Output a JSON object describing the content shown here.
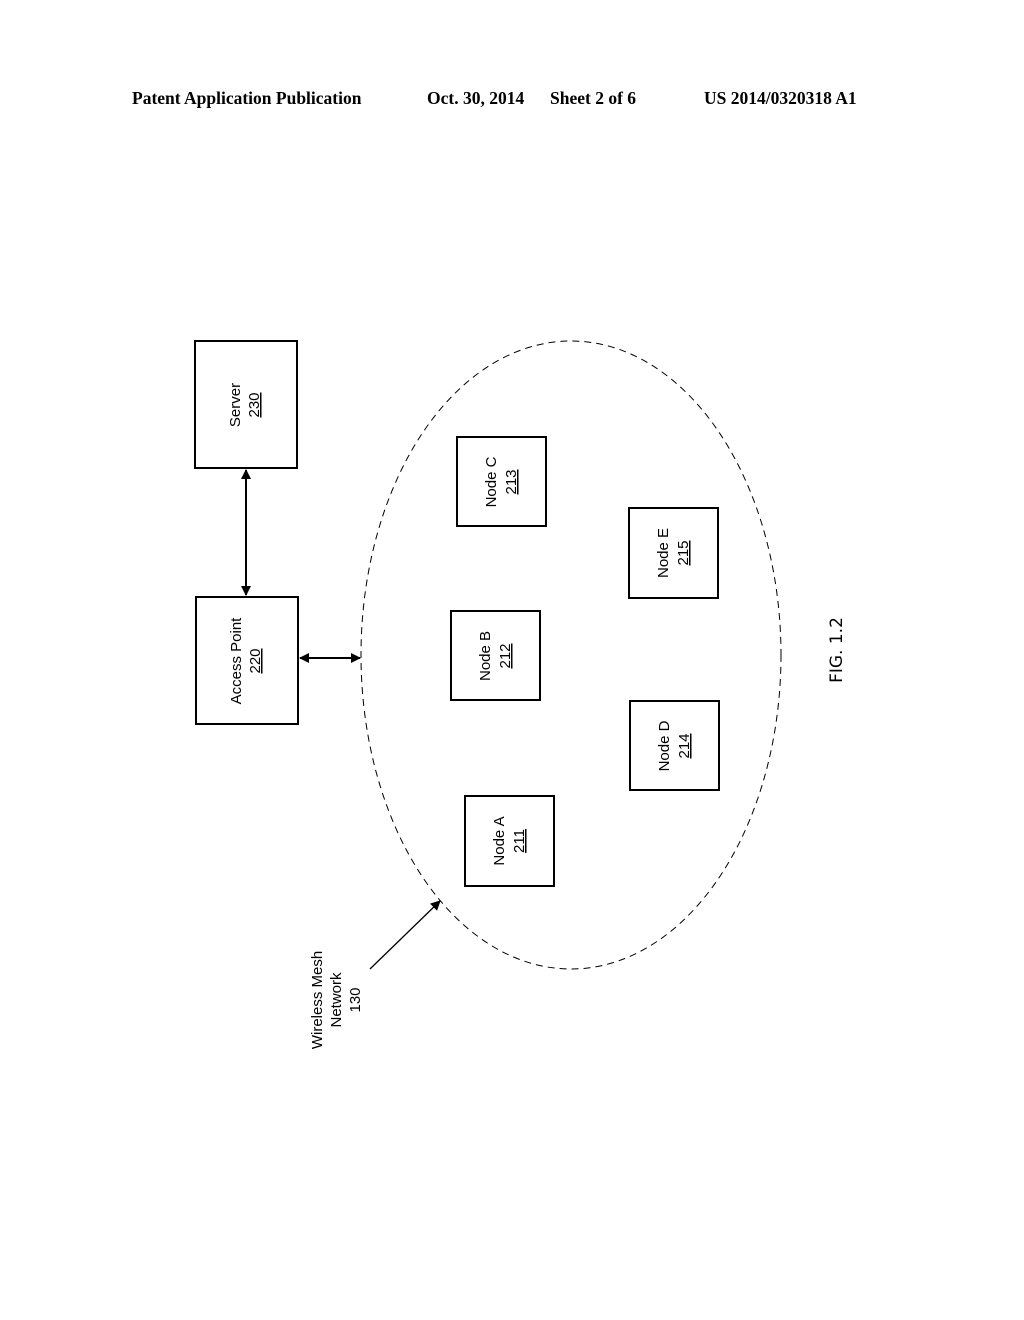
{
  "header": {
    "publication_type": "Patent Application Publication",
    "date": "Oct. 30, 2014",
    "sheet": "Sheet 2 of 6",
    "publication_number": "US 2014/0320318 A1"
  },
  "figure": {
    "label": "FIG. 1.2",
    "blocks": {
      "server": {
        "name": "Server",
        "ref": "230"
      },
      "access_point": {
        "name": "Access Point",
        "ref": "220"
      }
    },
    "network": {
      "line1": "Wireless Mesh",
      "line2": "Network",
      "ref": "130"
    },
    "nodes": [
      {
        "name": "Node A",
        "ref": "211"
      },
      {
        "name": "Node B",
        "ref": "212"
      },
      {
        "name": "Node C",
        "ref": "213"
      },
      {
        "name": "Node D",
        "ref": "214"
      },
      {
        "name": "Node E",
        "ref": "215"
      }
    ]
  }
}
